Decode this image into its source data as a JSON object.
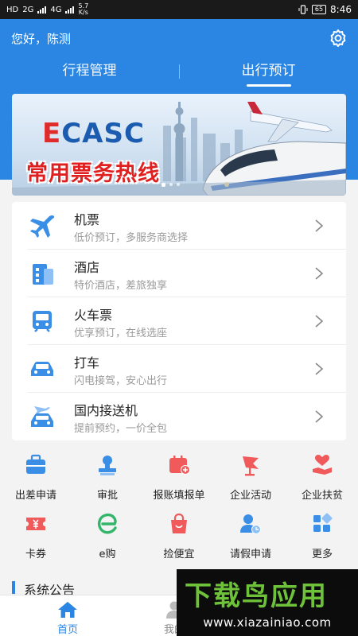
{
  "status_bar": {
    "left_tags": [
      "HD",
      "2G",
      "4G"
    ],
    "speed_value": "5.7",
    "speed_unit": "K/s",
    "battery": "65",
    "time": "8:46"
  },
  "header": {
    "greeting": "您好，陈测",
    "settings_icon": "gear-icon",
    "tabs": [
      {
        "label": "行程管理",
        "active": false
      },
      {
        "label": "出行预订",
        "active": true
      }
    ]
  },
  "banner": {
    "logo": {
      "e": "E",
      "rest": "CASC"
    },
    "title": "常用票务热线",
    "dots": 3,
    "active_dot": 0
  },
  "services": [
    {
      "title": "机票",
      "subtitle": "低价预订，多服务商选择",
      "icon": "airplane-icon"
    },
    {
      "title": "酒店",
      "subtitle": "特价酒店，差旅独享",
      "icon": "hotel-icon"
    },
    {
      "title": "火车票",
      "subtitle": "优享预订，在线选座",
      "icon": "train-icon"
    },
    {
      "title": "打车",
      "subtitle": "闪电接驾，安心出行",
      "icon": "car-icon"
    },
    {
      "title": "国内接送机",
      "subtitle": "提前预约，一价全包",
      "icon": "airport-transfer-icon"
    }
  ],
  "grid": [
    {
      "label": "出差申请",
      "icon": "suitcase-icon",
      "color": "#3a8ee6"
    },
    {
      "label": "审批",
      "icon": "stamp-icon",
      "color": "#3a8ee6"
    },
    {
      "label": "报账填报单",
      "icon": "calendar-plus-icon",
      "color": "#f05a5a"
    },
    {
      "label": "企业活动",
      "icon": "flag-icon",
      "color": "#f05a5a"
    },
    {
      "label": "企业扶贫",
      "icon": "heart-hand-icon",
      "color": "#f05a5a"
    },
    {
      "label": "卡券",
      "icon": "coupon-icon",
      "color": "#f05a5a"
    },
    {
      "label": "e购",
      "icon": "e-shop-icon",
      "color": "#33b56a"
    },
    {
      "label": "捡便宜",
      "icon": "shopping-bag-icon",
      "color": "#f05a5a"
    },
    {
      "label": "请假申请",
      "icon": "user-clock-icon",
      "color": "#3a8ee6"
    },
    {
      "label": "更多",
      "icon": "grid-more-icon",
      "color": "#3a8ee6"
    }
  ],
  "notice": {
    "title": "系统公告"
  },
  "bottom_nav": [
    {
      "label": "首页",
      "icon": "home-icon",
      "active": true
    },
    {
      "label": "我的",
      "icon": "user-icon",
      "active": false
    }
  ],
  "watermark": {
    "title": "下载鸟应用",
    "url": "www.xiazainiao.com"
  },
  "colors": {
    "primary": "#2a86e2",
    "red": "#f05a5a",
    "green": "#33b56a"
  }
}
